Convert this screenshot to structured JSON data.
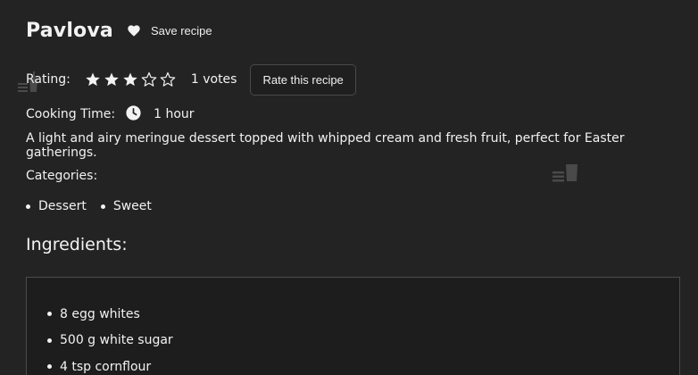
{
  "recipe": {
    "title": "Pavlova",
    "save_label": "Save recipe",
    "rating_label": "Rating:",
    "rating_value": 3,
    "rating_max": 5,
    "votes_text": "1 votes",
    "rate_button": "Rate this recipe",
    "cooking_time_label": "Cooking Time:",
    "cooking_time_value": "1 hour",
    "description": "A light and airy meringue dessert topped with whipped cream and fresh fruit, perfect for Easter gatherings.",
    "categories_label": "Categories:",
    "categories": [
      "Dessert",
      "Sweet"
    ],
    "ingredients_title": "Ingredients:",
    "ingredients": [
      "8 egg whites",
      "500 g white sugar",
      "4 tsp cornflour"
    ]
  },
  "icons": {
    "save": "heart-icon",
    "rating_filled": "star-filled-icon",
    "rating_empty": "star-outline-icon",
    "cooking_time": "clock-icon"
  },
  "colors": {
    "background": "#232323",
    "text": "#f2f2f2",
    "panel": "#1d1d1d",
    "border": "#4b4b4b"
  }
}
